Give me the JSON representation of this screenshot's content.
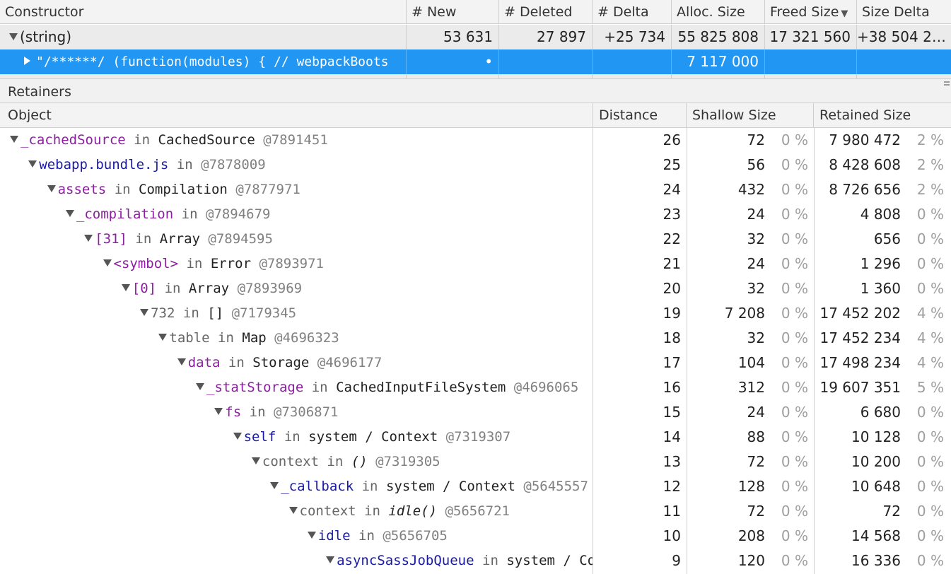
{
  "top_table": {
    "headers": {
      "constructor": "Constructor",
      "new": "# New",
      "deleted": "# Deleted",
      "delta": "# Delta",
      "alloc": "Alloc. Size",
      "freed": "Freed Size",
      "size_delta": "Size Delta"
    },
    "sort_icon": "triangle-down",
    "string_row": {
      "name": "(string)",
      "new": "53 631",
      "deleted": "27 897",
      "delta": "+25 734",
      "alloc": "55 825 808",
      "freed": "17 321 560",
      "size_delta": "+38 504 2…"
    },
    "selected_row": {
      "name": "\"/******/ (function(modules) { // webpackBoots",
      "new": "•",
      "alloc": "7 117 000"
    }
  },
  "retainers": {
    "title": "Retainers",
    "headers": {
      "object": "Object",
      "distance": "Distance",
      "shallow": "Shallow Size",
      "retained": "Retained Size"
    },
    "rows": [
      {
        "edge": "_cachedSource",
        "in": "in",
        "cls": "CachedSource",
        "id": "@7891451",
        "distance": "26",
        "shallow": "72",
        "shallow_pct": "0 %",
        "retained": "7 980 472",
        "retained_pct": "2 %"
      },
      {
        "edge": "webapp.bundle.js",
        "in": "in",
        "cls": "",
        "id": "@7878009",
        "distance": "25",
        "shallow": "56",
        "shallow_pct": "0 %",
        "retained": "8 428 608",
        "retained_pct": "2 %"
      },
      {
        "edge": "assets",
        "in": "in",
        "cls": "Compilation",
        "id": "@7877971",
        "distance": "24",
        "shallow": "432",
        "shallow_pct": "0 %",
        "retained": "8 726 656",
        "retained_pct": "2 %"
      },
      {
        "edge": "_compilation",
        "in": "in",
        "cls": "",
        "id": "@7894679",
        "distance": "23",
        "shallow": "24",
        "shallow_pct": "0 %",
        "retained": "4 808",
        "retained_pct": "0 %"
      },
      {
        "edge": "[31]",
        "in": "in",
        "cls": "Array",
        "id": "@7894595",
        "distance": "22",
        "shallow": "32",
        "shallow_pct": "0 %",
        "retained": "656",
        "retained_pct": "0 %"
      },
      {
        "edge": "<symbol>",
        "in": "in",
        "cls": "Error",
        "id": "@7893971",
        "distance": "21",
        "shallow": "24",
        "shallow_pct": "0 %",
        "retained": "1 296",
        "retained_pct": "0 %"
      },
      {
        "edge": "[0]",
        "in": "in",
        "cls": "Array",
        "id": "@7893969",
        "distance": "20",
        "shallow": "32",
        "shallow_pct": "0 %",
        "retained": "1 360",
        "retained_pct": "0 %"
      },
      {
        "edge": "732",
        "in": "in",
        "cls": "[]",
        "id": "@7179345",
        "distance": "19",
        "shallow": "7 208",
        "shallow_pct": "0 %",
        "retained": "17 452 202",
        "retained_pct": "4 %"
      },
      {
        "edge": "table",
        "in": "in",
        "cls": "Map",
        "id": "@4696323",
        "distance": "18",
        "shallow": "32",
        "shallow_pct": "0 %",
        "retained": "17 452 234",
        "retained_pct": "4 %"
      },
      {
        "edge": "data",
        "in": "in",
        "cls": "Storage",
        "id": "@4696177",
        "distance": "17",
        "shallow": "104",
        "shallow_pct": "0 %",
        "retained": "17 498 234",
        "retained_pct": "4 %"
      },
      {
        "edge": "_statStorage",
        "in": "in",
        "cls": "CachedInputFileSystem",
        "id": "@4696065",
        "distance": "16",
        "shallow": "312",
        "shallow_pct": "0 %",
        "retained": "19 607 351",
        "retained_pct": "5 %"
      },
      {
        "edge": "fs",
        "in": "in",
        "cls": "",
        "id": "@7306871",
        "distance": "15",
        "shallow": "24",
        "shallow_pct": "0 %",
        "retained": "6 680",
        "retained_pct": "0 %"
      },
      {
        "edge": "self",
        "in": "in",
        "cls": "system / Context",
        "id": "@7319307",
        "distance": "14",
        "shallow": "88",
        "shallow_pct": "0 %",
        "retained": "10 128",
        "retained_pct": "0 %"
      },
      {
        "edge": "context",
        "in": "in",
        "cls": "()",
        "id": "@7319305",
        "distance": "13",
        "shallow": "72",
        "shallow_pct": "0 %",
        "retained": "10 200",
        "retained_pct": "0 %"
      },
      {
        "edge": "_callback",
        "in": "in",
        "cls": "system / Context",
        "id": "@5645557",
        "distance": "12",
        "shallow": "128",
        "shallow_pct": "0 %",
        "retained": "10 648",
        "retained_pct": "0 %"
      },
      {
        "edge": "context",
        "in": "in",
        "cls": "idle()",
        "id": "@5656721",
        "distance": "11",
        "shallow": "72",
        "shallow_pct": "0 %",
        "retained": "72",
        "retained_pct": "0 %"
      },
      {
        "edge": "idle",
        "in": "in",
        "cls": "",
        "id": "@5656705",
        "distance": "10",
        "shallow": "208",
        "shallow_pct": "0 %",
        "retained": "14 568",
        "retained_pct": "0 %"
      },
      {
        "edge": "asyncSassJobQueue",
        "in": "in",
        "cls": "system / Co",
        "id": "",
        "distance": "9",
        "shallow": "120",
        "shallow_pct": "0 %",
        "retained": "16 336",
        "retained_pct": "0 %"
      }
    ]
  }
}
